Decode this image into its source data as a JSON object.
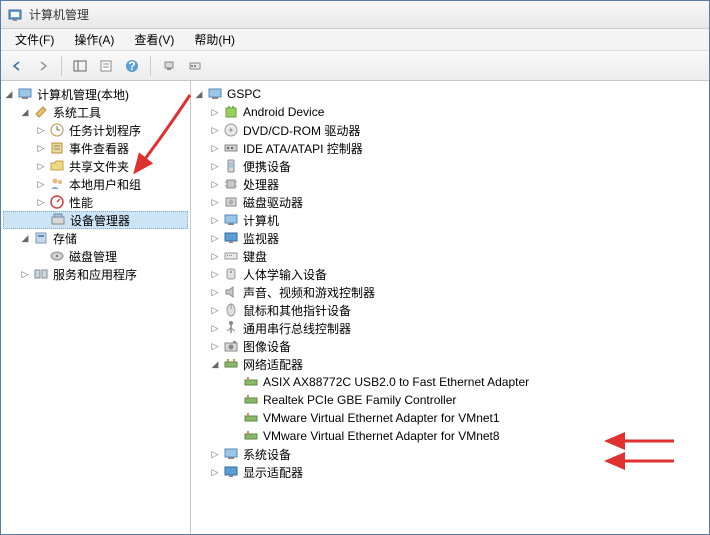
{
  "window": {
    "title": "计算机管理"
  },
  "menubar": {
    "file": "文件(F)",
    "action": "操作(A)",
    "view": "查看(V)",
    "help": "帮助(H)"
  },
  "left_tree": {
    "root": "计算机管理(本地)",
    "system_tools": "系统工具",
    "system_tools_children": {
      "task_scheduler": "任务计划程序",
      "event_viewer": "事件查看器",
      "shared_folders": "共享文件夹",
      "local_users": "本地用户和组",
      "performance": "性能",
      "device_manager": "设备管理器"
    },
    "storage": "存储",
    "storage_children": {
      "disk_mgmt": "磁盘管理"
    },
    "services_apps": "服务和应用程序"
  },
  "right_tree": {
    "root": "GSPC",
    "categories": {
      "android": "Android Device",
      "dvd": "DVD/CD-ROM 驱动器",
      "ide": "IDE ATA/ATAPI 控制器",
      "portable": "便携设备",
      "processor": "处理器",
      "disk_drive": "磁盘驱动器",
      "computer": "计算机",
      "monitor": "监视器",
      "keyboard": "键盘",
      "hid": "人体学输入设备",
      "audio": "声音、视频和游戏控制器",
      "mouse": "鼠标和其他指针设备",
      "usb": "通用串行总线控制器",
      "imaging": "图像设备",
      "network": "网络适配器",
      "system_dev": "系统设备",
      "display": "显示适配器"
    },
    "network_children": {
      "asix": "ASIX AX88772C USB2.0 to Fast Ethernet Adapter",
      "realtek": "Realtek PCIe GBE Family Controller",
      "vmnet1": "VMware Virtual Ethernet Adapter for VMnet1",
      "vmnet8": "VMware Virtual Ethernet Adapter for VMnet8"
    }
  }
}
